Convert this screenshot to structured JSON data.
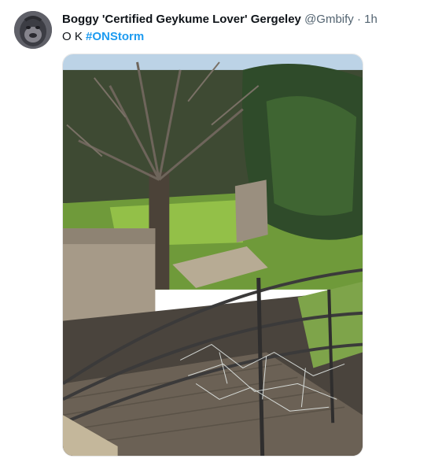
{
  "tweet": {
    "display_name": "Boggy 'Certified Geykume Lover' Gergeley",
    "handle": "@Gmbify",
    "separator": "·",
    "time": "1h",
    "text_prefix": "O K",
    "hashtag": "#ONStorm"
  },
  "icons": {
    "avatar": "gorilla-avatar"
  },
  "colors": {
    "hashtag": "#1d9bf0",
    "secondary_text": "#536471"
  }
}
